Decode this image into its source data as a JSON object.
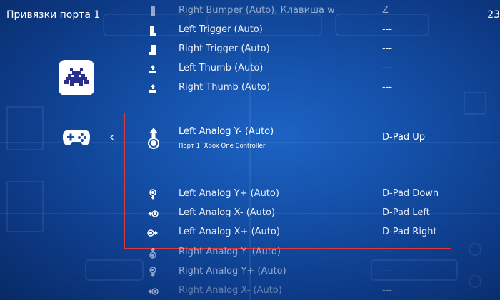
{
  "header": {
    "title": "Привязки порта 1",
    "right_text": "23"
  },
  "sidebar": {
    "logo_icon": "retroarch-invader-icon",
    "gamepad_icon": "gamepad-icon",
    "back_icon": "chevron-left-icon",
    "back_glyph": "‹"
  },
  "rows": [
    {
      "label": "Right Bumper (Auto), Клавиша w",
      "value": "Z",
      "icon": "right-bumper-icon"
    },
    {
      "label": "Left Trigger (Auto)",
      "value": "---",
      "icon": "left-trigger-icon"
    },
    {
      "label": "Right Trigger (Auto)",
      "value": "---",
      "icon": "right-trigger-icon"
    },
    {
      "label": "Left Thumb (Auto)",
      "value": "---",
      "icon": "left-thumb-icon"
    },
    {
      "label": "Right Thumb (Auto)",
      "value": "---",
      "icon": "right-thumb-icon"
    },
    {
      "label": "Left Analog Y- (Auto)",
      "sublabel": "Порт 1: Xbox One Controller",
      "value": "D-Pad Up",
      "icon": "analog-up-icon",
      "selected": true
    },
    {
      "label": "Left Analog Y+ (Auto)",
      "value": "D-Pad Down",
      "icon": "analog-down-icon"
    },
    {
      "label": "Left Analog X- (Auto)",
      "value": "D-Pad Left",
      "icon": "analog-left-icon"
    },
    {
      "label": "Left Analog X+ (Auto)",
      "value": "D-Pad Right",
      "icon": "analog-right-icon"
    },
    {
      "label": "Right Analog Y- (Auto)",
      "value": "---",
      "icon": "right-analog-down-icon"
    },
    {
      "label": "Right Analog Y+ (Auto)",
      "value": "---",
      "icon": "right-analog-up-icon"
    },
    {
      "label": "Right Analog X- (Auto)",
      "value": "---",
      "icon": "right-analog-left-icon"
    }
  ],
  "colors": {
    "background": "#1450a8",
    "selection_border": "#e0393a",
    "text": "#ffffff"
  }
}
